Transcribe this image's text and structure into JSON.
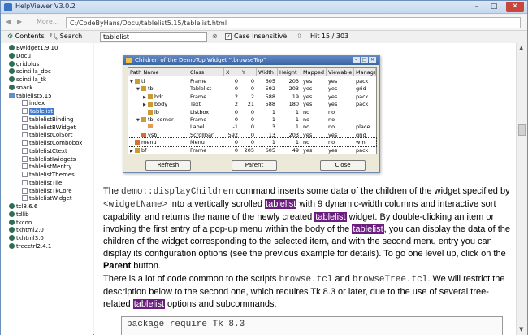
{
  "window": {
    "title": "HelpViewer V3.0.2",
    "min": "–",
    "max": "□",
    "close": "✕"
  },
  "nav": {
    "back": "◀",
    "more": "More...",
    "forward": "▶",
    "address": "C:/CodeByHans/Docu/tablelist5.15/tablelist.html"
  },
  "tabs": {
    "contents": "Contents",
    "search": "Search"
  },
  "search": {
    "value": "tablelist",
    "case_label": "Case Insensitive",
    "hit_label": "Hit 15 / 303",
    "prev": "⇩",
    "next": "⇧",
    "case_checked": "✓"
  },
  "sidebar": {
    "items": [
      {
        "label": "BWidget1.9.10",
        "type": "gear"
      },
      {
        "label": "Docu",
        "type": "gear"
      },
      {
        "label": "gridplus",
        "type": "gear"
      },
      {
        "label": "scintilla_doc",
        "type": "gear"
      },
      {
        "label": "scintilla_tk",
        "type": "gear"
      },
      {
        "label": "snack",
        "type": "gear"
      },
      {
        "label": "tablelist5.15",
        "type": "folder"
      },
      {
        "label": "index",
        "type": "page"
      },
      {
        "label": "tablelist",
        "type": "page",
        "selected": true
      },
      {
        "label": "tablelistBinding",
        "type": "page"
      },
      {
        "label": "tablelistBWidget",
        "type": "page"
      },
      {
        "label": "tablelistColSort",
        "type": "page"
      },
      {
        "label": "tablelistCombobox",
        "type": "page"
      },
      {
        "label": "tablelistCtext",
        "type": "page"
      },
      {
        "label": "tablelistIwidgets",
        "type": "page"
      },
      {
        "label": "tablelistMentry",
        "type": "page"
      },
      {
        "label": "tablelistThemes",
        "type": "page"
      },
      {
        "label": "tablelistTile",
        "type": "page"
      },
      {
        "label": "tablelistTkCore",
        "type": "page"
      },
      {
        "label": "tablelistWidget",
        "type": "page"
      },
      {
        "label": "tcl8.6.6",
        "type": "gear"
      },
      {
        "label": "tdlib",
        "type": "gear"
      },
      {
        "label": "tkcon",
        "type": "gear"
      },
      {
        "label": "tkhtml2.0",
        "type": "gear"
      },
      {
        "label": "tkhtml3.0",
        "type": "gear"
      },
      {
        "label": "treectrl2.4.1",
        "type": "gear"
      }
    ]
  },
  "dialog": {
    "title": "Children of the DemoTop Widget \".browseTop\"",
    "columns": [
      "Path Name",
      "Class",
      "X",
      "Y",
      "Width",
      "Height",
      "Mapped",
      "Viewable",
      "Manager"
    ],
    "rows": [
      {
        "icon": "frame",
        "tri": "▼",
        "indent": 0,
        "cells": [
          "tf",
          "Frame",
          "0",
          "0",
          "605",
          "203",
          "yes",
          "yes",
          "pack"
        ]
      },
      {
        "icon": "frame",
        "tri": "▼",
        "indent": 1,
        "cells": [
          "tbl",
          "Tablelist",
          "0",
          "0",
          "592",
          "203",
          "yes",
          "yes",
          "grid"
        ]
      },
      {
        "icon": "frame",
        "tri": "▶",
        "indent": 2,
        "cells": [
          "hdr",
          "Frame",
          "2",
          "2",
          "588",
          "19",
          "yes",
          "yes",
          "pack"
        ]
      },
      {
        "icon": "frame",
        "tri": "▶",
        "indent": 2,
        "cells": [
          "body",
          "Text",
          "2",
          "21",
          "588",
          "180",
          "yes",
          "yes",
          "pack"
        ]
      },
      {
        "icon": "frame",
        "tri": "",
        "indent": 2,
        "cells": [
          "lb",
          "Listbox",
          "0",
          "0",
          "1",
          "1",
          "no",
          "no",
          ""
        ]
      },
      {
        "icon": "frame",
        "tri": "▼",
        "indent": 1,
        "cells": [
          "tbl-corner",
          "Frame",
          "0",
          "0",
          "1",
          "1",
          "no",
          "no",
          ""
        ]
      },
      {
        "icon": "lbl",
        "tri": "",
        "indent": 2,
        "cells": [
          "l",
          "Label",
          "-1",
          "0",
          "3",
          "1",
          "no",
          "no",
          "place"
        ]
      },
      {
        "icon": "menu",
        "tri": "",
        "indent": 1,
        "cells": [
          "vsb",
          "Scrollbar",
          "592",
          "0",
          "13",
          "203",
          "yes",
          "yes",
          "grid"
        ]
      },
      {
        "icon": "menu",
        "tri": "",
        "indent": 0,
        "cells": [
          "menu",
          "Menu",
          "0",
          "0",
          "1",
          "1",
          "no",
          "no",
          "wm"
        ],
        "selected": true
      },
      {
        "icon": "frame",
        "tri": "▶",
        "indent": 0,
        "cells": [
          "bf",
          "Frame",
          "0",
          "205",
          "605",
          "49",
          "yes",
          "yes",
          "pack"
        ]
      }
    ],
    "buttons": {
      "refresh": "Refresh",
      "parent": "Parent",
      "close": "Close"
    }
  },
  "content": {
    "p1": {
      "t1": "The ",
      "c1": "demo::displayChildren",
      "t2": " command inserts some data of the children of the widget specified by ",
      "c2": "<widgetName>",
      "t3": " into a vertically scrolled ",
      "h1": "tablelist",
      "t4": " with 9 dynamic-width columns and interactive sort capability, and returns the name of the newly created ",
      "h2": "tablelist",
      "t5": " widget.  By double-clicking an item or invoking the first entry of a pop-up menu within the body of the ",
      "h3": "tablelist",
      "t6": ", you can display the data of the children of the widget corresponding to the selected item, and with the second menu entry you can display its configuration options (see the previous example for details).  To go one level up, click on the ",
      "b1": "Parent",
      "t7": " button."
    },
    "p2": {
      "t1": "There is a lot of code common to the scripts ",
      "c1": "browse.tcl",
      "t2": " and ",
      "c2": "browseTree.tcl",
      "t3": ".  We will restrict the description below to the second one, which requires Tk 8.3 or later, due to the use of several tree-related ",
      "h1": "tablelist",
      "t4": " options and subcommands."
    },
    "code": "package require Tk 8.3"
  }
}
